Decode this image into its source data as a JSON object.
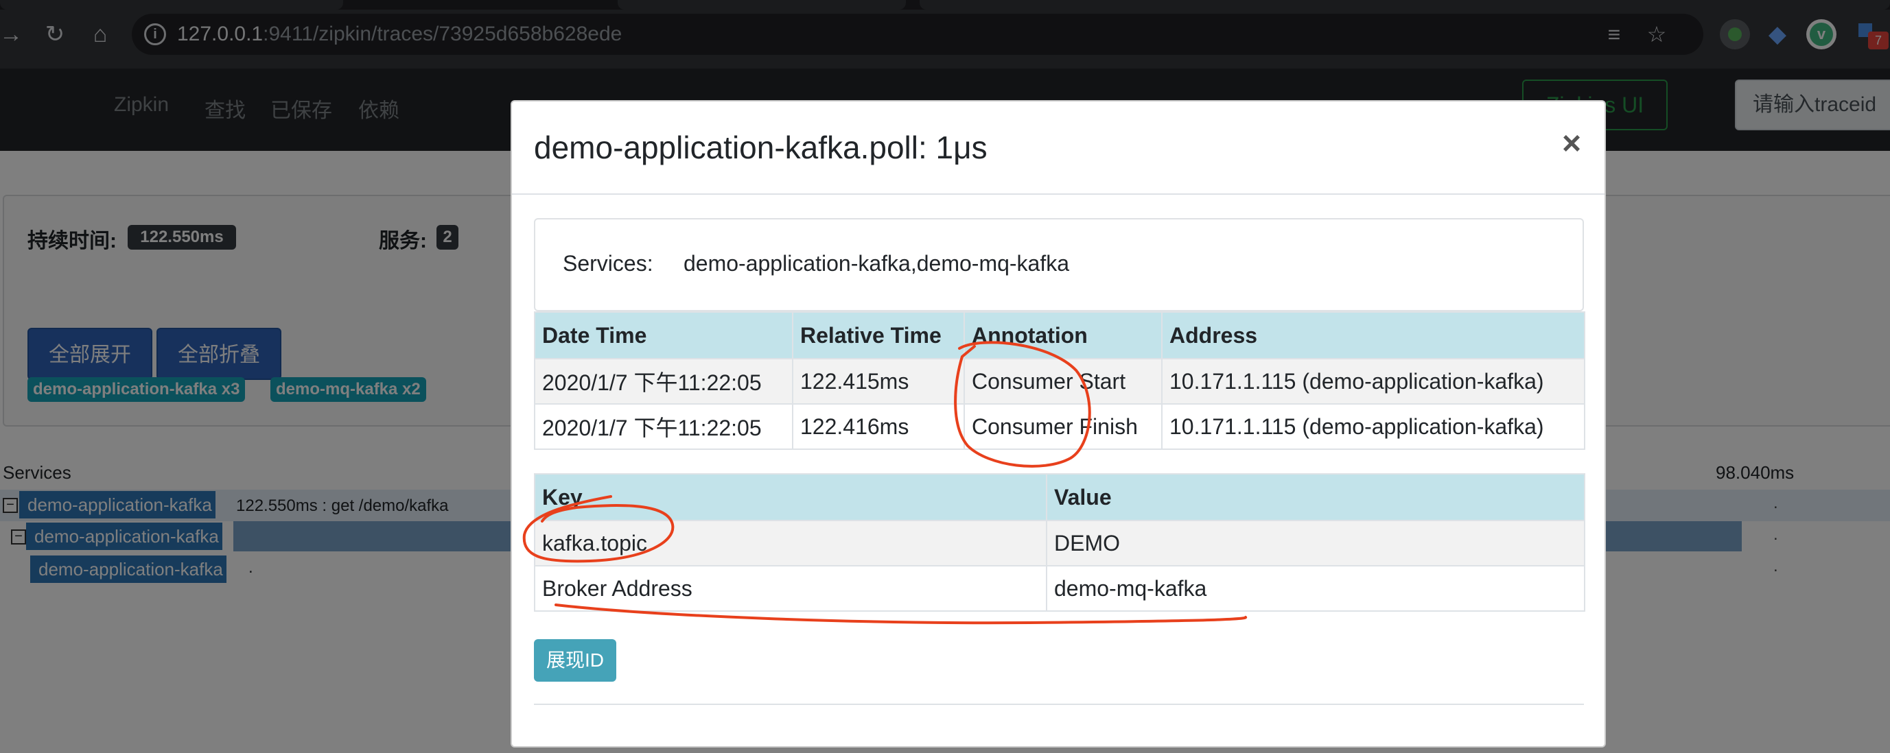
{
  "browser": {
    "url_host": "127.0.0.1",
    "url_rest": ":9411/zipkin/traces/73925d658b628ede",
    "ext_badge": "7"
  },
  "app": {
    "brand": "Zipkin",
    "nav_links": [
      "查找",
      "已保存",
      "依赖"
    ],
    "legacy_button": "Zipkins UI",
    "traceid_placeholder": "请输入traceid"
  },
  "summary": {
    "duration_label": "持续时间:",
    "duration_value": "122.550ms",
    "services_label": "服务:",
    "services_count": "2",
    "expand_all": "全部展开",
    "collapse_all": "全部折叠",
    "service_tags": [
      "demo-application-kafka x3",
      "demo-mq-kafka x2"
    ],
    "services_header": "Services",
    "timeline_label": "98.040ms",
    "spans": [
      {
        "toggle": "⊟",
        "name": "demo-application-kafka",
        "info": "122.550ms : get /demo/kafka",
        "dot": "."
      },
      {
        "toggle": "⊟",
        "name": "demo-application-kafka",
        "info": ".",
        "dot": "."
      },
      {
        "toggle": "",
        "name": "demo-application-kafka",
        "info": ".",
        "dot": "."
      }
    ]
  },
  "modal": {
    "title": "demo-application-kafka.poll: 1μs",
    "close": "×",
    "services_key": "Services:",
    "services_value": "demo-application-kafka,demo-mq-kafka",
    "annotation_headers": [
      "Date Time",
      "Relative Time",
      "Annotation",
      "Address"
    ],
    "annotations": [
      [
        "2020/1/7 下午11:22:05",
        "122.415ms",
        "Consumer Start",
        "10.171.1.115 (demo-application-kafka)"
      ],
      [
        "2020/1/7 下午11:22:05",
        "122.416ms",
        "Consumer Finish",
        "10.171.1.115 (demo-application-kafka)"
      ]
    ],
    "tag_headers": [
      "Key",
      "Value"
    ],
    "tags": [
      [
        "kafka.topic",
        "DEMO"
      ],
      [
        "Broker Address",
        "demo-mq-kafka"
      ]
    ],
    "show_id_button": "展现ID"
  },
  "colors": {
    "annotation_ink": "#e8401c",
    "table_header": "#c2e3ea",
    "primary_button": "#2e63b8",
    "info_tag": "#17a2b8"
  }
}
